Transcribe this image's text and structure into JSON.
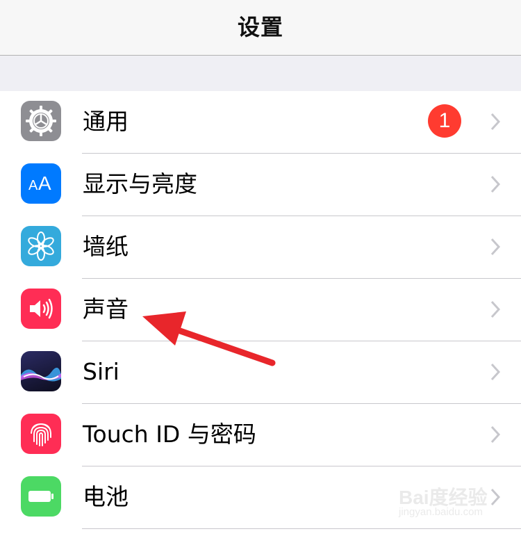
{
  "navbar": {
    "title": "设置"
  },
  "settings": {
    "items": [
      {
        "label": "通用",
        "icon": "gear-icon",
        "icon_color": "#8e8e93",
        "badge": "1"
      },
      {
        "label": "显示与亮度",
        "icon": "text-size-icon",
        "icon_color": "#007aff"
      },
      {
        "label": "墙纸",
        "icon": "flower-icon",
        "icon_color": "#34aadc"
      },
      {
        "label": "声音",
        "icon": "speaker-icon",
        "icon_color": "#ff2d55"
      },
      {
        "label": "Siri",
        "icon": "siri-icon",
        "icon_color": "#1c1c3a"
      },
      {
        "label": "Touch ID 与密码",
        "icon": "fingerprint-icon",
        "icon_color": "#ff2d55"
      },
      {
        "label": "电池",
        "icon": "battery-icon",
        "icon_color": "#4cd964"
      }
    ]
  },
  "annotation": {
    "arrow_color": "#e8262b"
  },
  "watermark": {
    "logo": "Bai度经验",
    "url": "jingyan.baidu.com"
  }
}
